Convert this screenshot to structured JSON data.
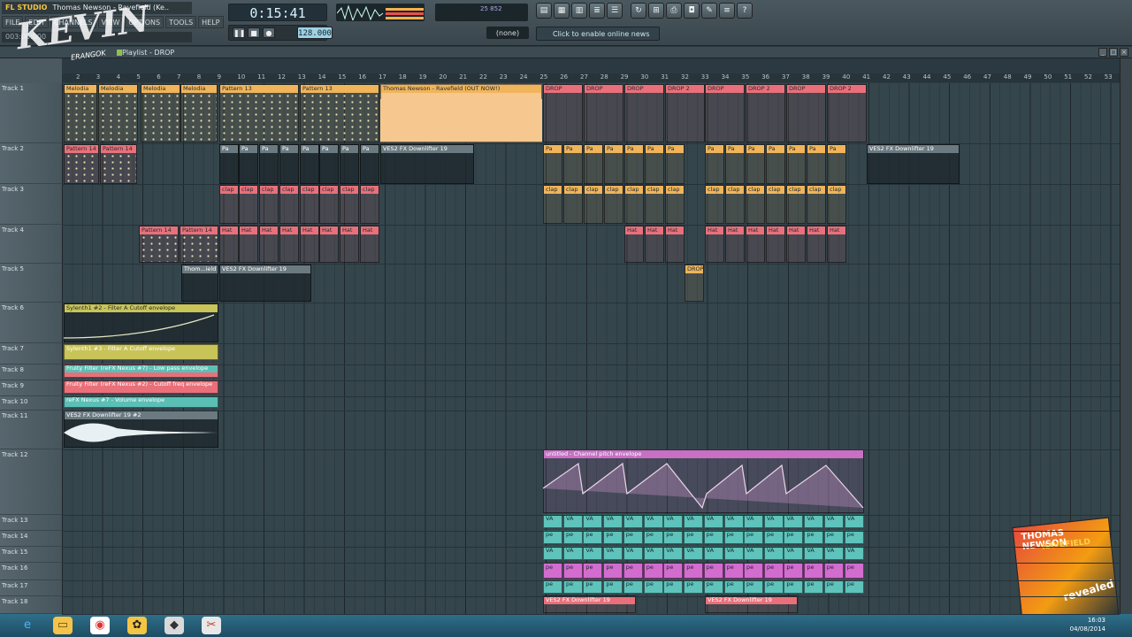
{
  "app": {
    "brand": "FL STUDIO",
    "title": "Thomas Newson - Ravefield (Ke..",
    "menu": [
      "FILE",
      "EDIT",
      "CHANNELS",
      "VIEW",
      "OPTIONS",
      "TOOLS",
      "HELP"
    ],
    "hint": "003:06:000",
    "song_time": "0:15:41",
    "tempo": "128.000",
    "pattern": "(none)",
    "online_news": "Click to enable online news",
    "meter_val_a": "25",
    "meter_val_b": "852"
  },
  "playlist": {
    "title": "Playlist - DROP",
    "ruler": [
      "2",
      "3",
      "4",
      "5",
      "6",
      "7",
      "8",
      "9",
      "10",
      "11",
      "12",
      "13",
      "14",
      "15",
      "16",
      "17",
      "18",
      "19",
      "20",
      "21",
      "22",
      "23",
      "24",
      "25",
      "26",
      "27",
      "28",
      "29",
      "30",
      "31",
      "32",
      "33",
      "34",
      "35",
      "36",
      "37",
      "38",
      "39",
      "40",
      "41",
      "42",
      "43",
      "44",
      "45",
      "46",
      "47",
      "48",
      "49",
      "50",
      "51",
      "52",
      "53"
    ],
    "tracks": [
      "Track 1",
      "Track 2",
      "Track 3",
      "Track 4",
      "Track 5",
      "Track 6",
      "Track 7",
      "Track 8",
      "Track 9",
      "Track 10",
      "Track 11",
      "Track 12",
      "Track 13",
      "Track 14",
      "Track 15",
      "Track 16",
      "Track 17",
      "Track 18"
    ],
    "clips": {
      "t1_melodia": "Melodia",
      "t1_pattern13": "Pattern 13",
      "t1_ravefield": "Thomas Newson - Ravefield (OUT NOW!)",
      "t1_drop": "DROP",
      "t1_drop2": "DROP 2",
      "t2_pattern14": "Pattern 14",
      "t2_pa": "Pa",
      "t2_downlifter": "VES2 FX Downlifter 19",
      "t3_clap": "clap",
      "t4_pattern14": "Pattern 14",
      "t4_hat": "Hat",
      "t5_thom": "Thom...ield",
      "t5_downlifter": "VES2 FX Downlifter 19",
      "t6_env": "Sylenth1 #2 - Filter A Cutoff envelope",
      "t7_env": "Sylenth1 #3 - Filter A Cutoff envelope",
      "t8_env": "Fruity Filter (reFX Nexus #7) - Low pass envelope",
      "t9_env": "Fruity Filter (reFX Nexus #2) - Cutoff freq envelope",
      "t10_env": "reFX Nexus #7 - Volume envelope",
      "t11_audio": "VES2 FX Downlifter 19 #2",
      "t12_env": "untitled - Channel pitch envelope",
      "t13_va": "VA",
      "t14_pe": "pe",
      "t18_downlifter": "VES2 FX Downlifter 19"
    }
  },
  "taskbar": {
    "time": "16:03",
    "date": "04/08/2014"
  },
  "overlay": {
    "watermark": "KEVIN",
    "watermark_sub": "ERANGOK",
    "album_artist": "THOMAS NEWSON",
    "album_title": "RAVEFIELD",
    "album_label": "revealed"
  },
  "colors": {
    "orange": "#f0b45a",
    "red": "#e9707a",
    "teal": "#5bbfb5",
    "pink": "#c770c4",
    "yellow": "#c9c458"
  }
}
